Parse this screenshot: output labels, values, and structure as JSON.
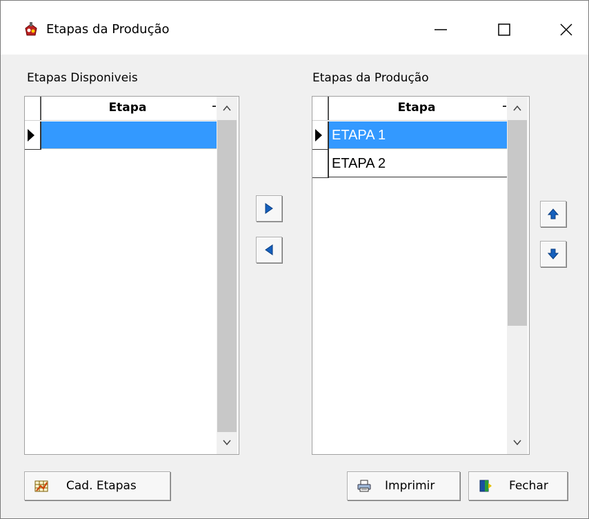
{
  "window": {
    "title": "Etapas da Produção"
  },
  "left_panel": {
    "label": "Etapas Disponiveis",
    "column_header": "Etapa",
    "rows": [
      ""
    ]
  },
  "right_panel": {
    "label": "Etapas da Produção",
    "column_header": "Etapa",
    "rows": [
      "ETAPA 1",
      "ETAPA 2"
    ]
  },
  "buttons": {
    "cad_etapas": "Cad. Etapas",
    "imprimir": "Imprimir",
    "fechar": "Fechar"
  },
  "icons": {
    "move_right": "arrow-right-icon",
    "move_left": "arrow-left-icon",
    "move_up": "arrow-up-icon",
    "move_down": "arrow-down-icon"
  },
  "colors": {
    "selection": "#3399ff",
    "accent_blue": "#1560bd"
  }
}
